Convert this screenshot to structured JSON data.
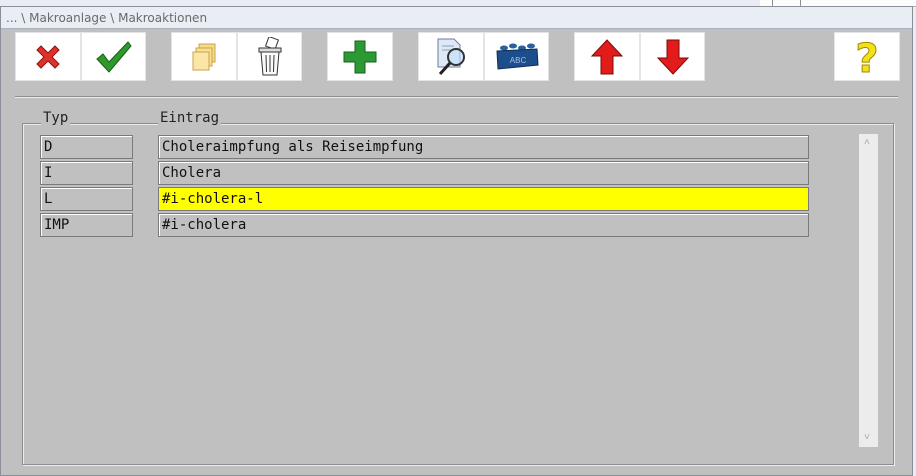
{
  "window": {
    "title": "... \\ Makroanlage \\ Makroaktionen"
  },
  "toolbar": {
    "buttons": [
      {
        "name": "cancel-button",
        "icon": "red-x-icon"
      },
      {
        "name": "confirm-button",
        "icon": "green-check-icon"
      },
      {
        "name": "copy-button",
        "icon": "stack-icon"
      },
      {
        "name": "delete-button",
        "icon": "trash-icon"
      },
      {
        "name": "add-button",
        "icon": "green-plus-icon"
      },
      {
        "name": "search-button",
        "icon": "magnifier-icon"
      },
      {
        "name": "abc-block-button",
        "icon": "blue-abc-brick-icon",
        "brick_text": "ABC"
      },
      {
        "name": "move-up-button",
        "icon": "red-arrow-up-icon"
      },
      {
        "name": "move-down-button",
        "icon": "red-arrow-down-icon"
      },
      {
        "name": "help-button",
        "icon": "yellow-question-icon",
        "glyph": "?"
      }
    ]
  },
  "table": {
    "headers": {
      "typ": "Typ",
      "eintrag": "Eintrag"
    },
    "rows": [
      {
        "typ": "D",
        "eintrag": "Choleraimpfung als Reiseimpfung",
        "highlight": false
      },
      {
        "typ": "I",
        "eintrag": "Cholera",
        "highlight": false
      },
      {
        "typ": "L",
        "eintrag": "#i-cholera-l",
        "highlight": true
      },
      {
        "typ": "IMP",
        "eintrag": "#i-cholera",
        "highlight": false
      }
    ]
  },
  "scrollbar": {
    "up_glyph": "˄",
    "down_glyph": "˅"
  },
  "colors": {
    "highlight": "#ffff00",
    "window_bg": "#c0c0c0"
  }
}
